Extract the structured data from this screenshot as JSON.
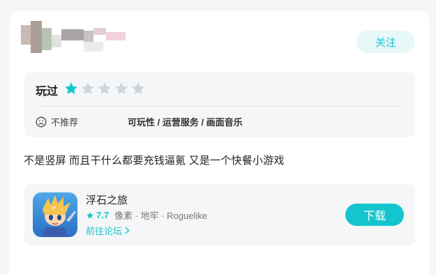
{
  "header": {
    "follow_label": "关注"
  },
  "rating": {
    "played_label": "玩过",
    "stars_filled": 1,
    "stars_total": 5,
    "recommend_label": "不推荐",
    "tags_text": "可玩性 / 运营服务 / 画面音乐"
  },
  "review": {
    "text": "不是竖屏 而且干什么都要充钱逼氪 又是一个快餐小游戏"
  },
  "game": {
    "name": "浮石之旅",
    "score": "7.7",
    "tags": "像素 · 地牢 · Roguelike",
    "forum_link": "前往论坛",
    "download_label": "下载"
  },
  "colors": {
    "accent": "#15c5ce",
    "accent_light": "#e8f7f7",
    "star_empty": "#cfd5d9"
  }
}
